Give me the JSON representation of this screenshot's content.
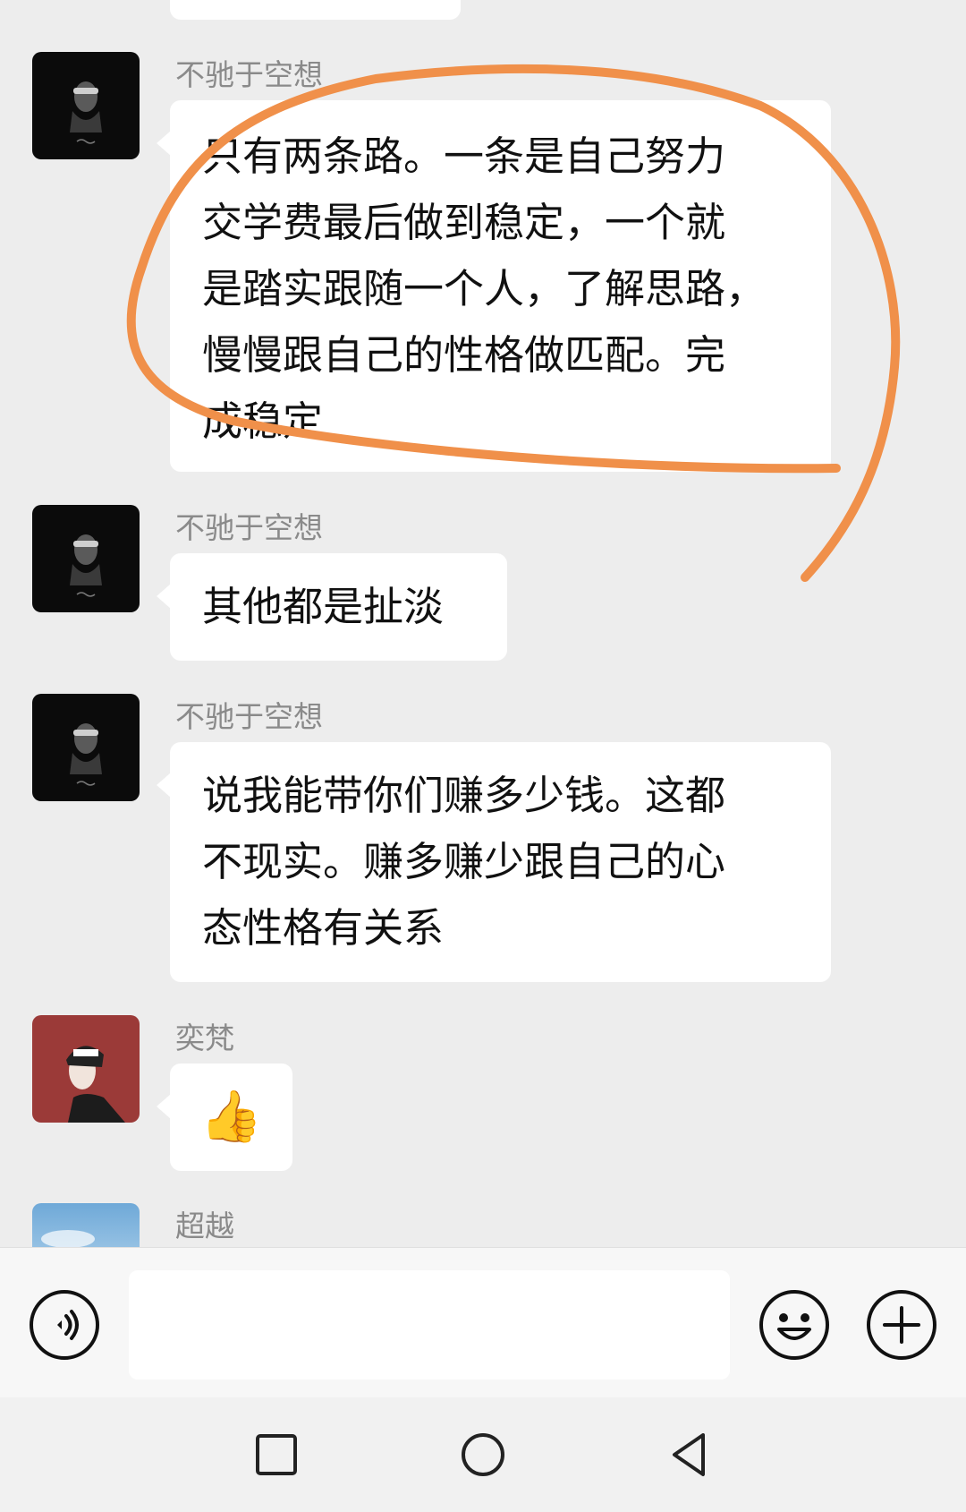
{
  "messages": [
    {
      "sender": "不驰于空想",
      "avatar": "masked-man-avatar",
      "lines": [
        "只有两条路。一条是自己努力",
        "交学费最后做到稳定，一个就",
        "是踏实跟随一个人，了解思路，",
        "慢慢跟自己的性格做匹配。完",
        "成稳定"
      ]
    },
    {
      "sender": "不驰于空想",
      "avatar": "masked-man-avatar",
      "lines": [
        "其他都是扯淡"
      ]
    },
    {
      "sender": "不驰于空想",
      "avatar": "masked-man-avatar",
      "lines": [
        "说我能带你们赚多少钱。这都",
        "不现实。赚多赚少跟自己的心",
        "态性格有关系"
      ]
    },
    {
      "sender": "奕梵",
      "avatar": "hooded-man-avatar",
      "emoji": "👍"
    },
    {
      "sender": "超越",
      "avatar": "sky-avatar"
    }
  ],
  "input_bar": {
    "placeholder": ""
  },
  "colors": {
    "annotation": "#f0904a",
    "background": "#ededed",
    "bubble": "#ffffff"
  }
}
